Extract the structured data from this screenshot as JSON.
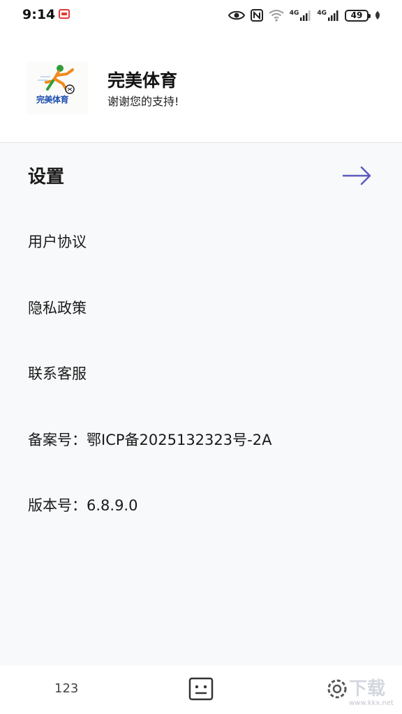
{
  "status_bar": {
    "time": "9:14",
    "network_1": "4G",
    "network_2": "4G",
    "battery": "49"
  },
  "header": {
    "app_name": "完美体育",
    "slogan": "谢谢您的支持!",
    "logo_text": "完美体育"
  },
  "menu": {
    "settings": "设置",
    "user_agreement": "用户协议",
    "privacy_policy": "隐私政策",
    "customer_service": "联系客服",
    "icp": "备案号：鄂ICP备2025132323号-2A",
    "version": "版本号：6.8.9.0"
  },
  "bottom_nav": {
    "tab_1": "123"
  },
  "watermark": {
    "text": "下载",
    "url": "www.kkx.net"
  },
  "colors": {
    "accent": "#5b5bbf",
    "content_bg": "#f8f9fb"
  }
}
